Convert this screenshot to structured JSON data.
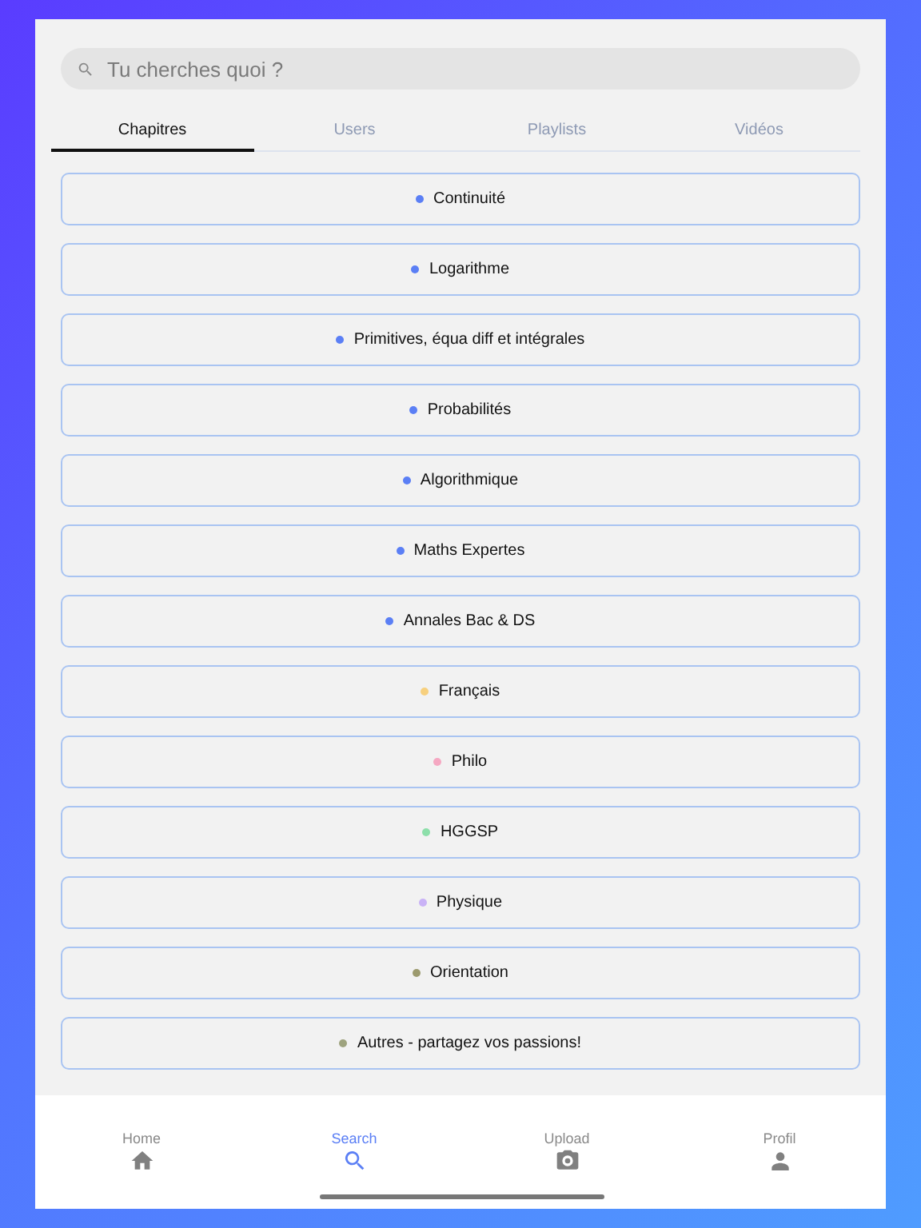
{
  "search": {
    "placeholder": "Tu cherches quoi ?"
  },
  "tabs": [
    {
      "label": "Chapitres",
      "selected": true
    },
    {
      "label": "Users",
      "selected": false
    },
    {
      "label": "Playlists",
      "selected": false
    },
    {
      "label": "Vidéos",
      "selected": false
    }
  ],
  "chapters": [
    {
      "label": "Continuité",
      "color": "#5b7ff5"
    },
    {
      "label": "Logarithme",
      "color": "#5b7ff5"
    },
    {
      "label": "Primitives, équa diff et intégrales",
      "color": "#5b7ff5"
    },
    {
      "label": "Probabilités",
      "color": "#5b7ff5"
    },
    {
      "label": "Algorithmique",
      "color": "#5b7ff5"
    },
    {
      "label": "Maths Expertes",
      "color": "#5b7ff5"
    },
    {
      "label": "Annales Bac & DS",
      "color": "#5b7ff5"
    },
    {
      "label": "Français",
      "color": "#f7d07e"
    },
    {
      "label": "Philo",
      "color": "#f5a8c2"
    },
    {
      "label": "HGGSP",
      "color": "#8ddfaa"
    },
    {
      "label": "Physique",
      "color": "#c9b2f6"
    },
    {
      "label": "Orientation",
      "color": "#9c9a6e"
    },
    {
      "label": "Autres - partagez vos passions!",
      "color": "#9ea37e"
    }
  ],
  "nav": [
    {
      "kind": "home",
      "label": "Home",
      "selected": false
    },
    {
      "kind": "search",
      "label": "Search",
      "selected": true
    },
    {
      "kind": "upload",
      "label": "Upload",
      "selected": false
    },
    {
      "kind": "profile",
      "label": "Profil",
      "selected": false
    }
  ]
}
